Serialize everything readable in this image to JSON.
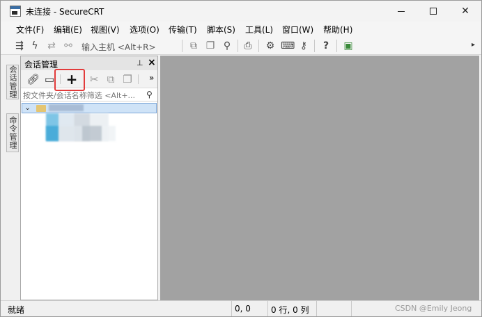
{
  "window": {
    "title": "未连接 - SecureCRT"
  },
  "menu": {
    "items": [
      "文件(F)",
      "编辑(E)",
      "视图(V)",
      "选项(O)",
      "传输(T)",
      "脚本(S)",
      "工具(L)",
      "窗口(W)",
      "帮助(H)"
    ]
  },
  "toolbar": {
    "host_prompt": "输入主机 <Alt+R>",
    "icons": [
      "connect-bar-icon",
      "lightning-icon",
      "reconnect-icon",
      "disconnect-icon",
      "copy-icon",
      "paste-icon",
      "find-icon",
      "print-icon",
      "settings-icon",
      "keymap-icon",
      "key-icon",
      "help-icon",
      "image-icon"
    ]
  },
  "side_tabs": {
    "tab1": "会话管理",
    "tab2": "命令管理"
  },
  "session_panel": {
    "title": "会话管理",
    "pin_glyph": "⊥",
    "close_glyph": "×",
    "filter_placeholder": "按文件夹/会话名称筛选 <Alt+...",
    "more_glyph": "»"
  },
  "status": {
    "text": "就绪",
    "position": "0, 0",
    "rows_cols": "0 行, 0 列",
    "watermark": "CSDN @Emily Jeong"
  },
  "colors": {
    "terminal_bg": "#a2a2a2",
    "highlight": "#e23b3b",
    "tree_selection": "#cfe3f7"
  }
}
